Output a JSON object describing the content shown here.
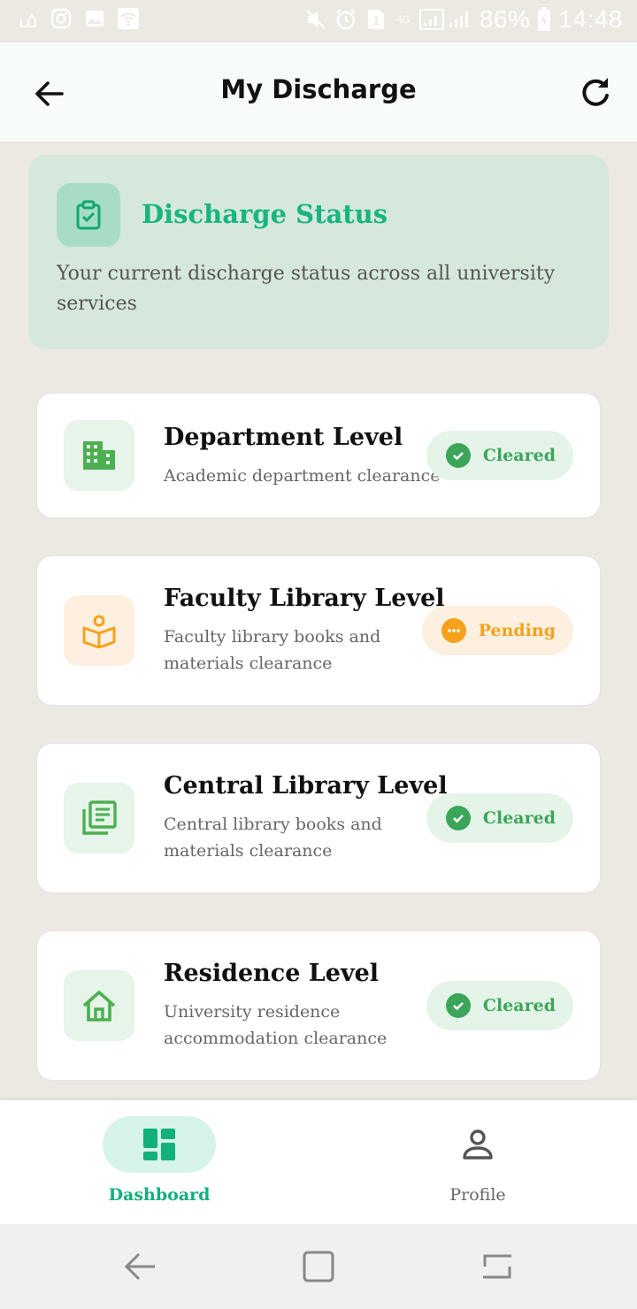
{
  "status_bar": {
    "battery": "86%",
    "time": "14:48",
    "sim_badge": "1",
    "network": "4G"
  },
  "app_bar": {
    "title": "My Discharge",
    "back_icon": "arrow-left-icon",
    "refresh_icon": "refresh-icon"
  },
  "summary": {
    "icon": "clipboard-check-icon",
    "title": "Discharge Status",
    "description": "Your current discharge status across all university services"
  },
  "levels": [
    {
      "title": "Department Level",
      "description": "Academic department clearance",
      "icon": "building-icon",
      "status": "Cleared"
    },
    {
      "title": "Faculty Library Level",
      "description": "Faculty library books and materials clearance",
      "icon": "book-reader-icon",
      "status": "Pending"
    },
    {
      "title": "Central Library Level",
      "description": "Central library books and materials clearance",
      "icon": "library-books-icon",
      "status": "Cleared"
    },
    {
      "title": "Residence Level",
      "description": "University residence accommodation clearance",
      "icon": "home-icon",
      "status": "Cleared"
    }
  ],
  "bottom_nav": {
    "items": [
      {
        "label": "Dashboard",
        "icon": "dashboard-icon",
        "active": true
      },
      {
        "label": "Profile",
        "icon": "person-icon",
        "active": false
      }
    ]
  },
  "colors": {
    "accent": "#12b07a",
    "cleared": "#3ba55a",
    "pending": "#f5a21a",
    "background": "#ece9e2"
  }
}
